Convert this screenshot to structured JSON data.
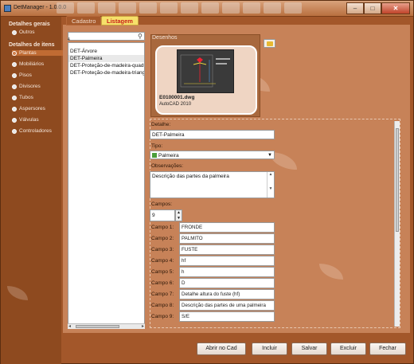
{
  "window": {
    "title": "DetManager - 1.0.0.0",
    "minimize": "–",
    "maximize": "□",
    "close": "✕"
  },
  "sidebar": {
    "general_title": "Detalhes gerais",
    "general_items": [
      {
        "label": "Outros"
      }
    ],
    "items_title": "Detalhes de itens",
    "items": [
      {
        "label": "Plantas",
        "selected": true
      },
      {
        "label": "Mobiliários"
      },
      {
        "label": "Pisos"
      },
      {
        "label": "Divisores"
      },
      {
        "label": "Tubos"
      },
      {
        "label": "Aspersores"
      },
      {
        "label": "Válvulas"
      },
      {
        "label": "Controladores"
      }
    ]
  },
  "tabs": [
    {
      "label": "Cadastro"
    },
    {
      "label": "Listagem",
      "active": true
    }
  ],
  "list": {
    "count_marker": "4",
    "items": [
      "DET-Árvore",
      "DET-Palmeira",
      "DET-Proteção-de-madeira-quadrada",
      "DET-Proteção-de-madeira-triangular"
    ],
    "selected_index": 1
  },
  "drawings": {
    "label": "Desenhos",
    "file": "E0100001.dwg",
    "app": "AutoCAD 2010"
  },
  "form": {
    "detalhe_label": "Detalhe:",
    "detalhe_value": "DET-Palmeira",
    "tipo_label": "Tipo:",
    "tipo_value": "Palmeira",
    "obs_label": "Observações:",
    "obs_value": "Descrição das partes da palmeira",
    "campos_label": "Campos:",
    "campos_value": "9"
  },
  "campos": [
    {
      "label": "Campo 1:",
      "value": "FRONDE"
    },
    {
      "label": "Campo 2:",
      "value": "PALMITO"
    },
    {
      "label": "Campo 3:",
      "value": "FUSTE"
    },
    {
      "label": "Campo 4:",
      "value": "hf"
    },
    {
      "label": "Campo 5:",
      "value": "h"
    },
    {
      "label": "Campo 6:",
      "value": "D"
    },
    {
      "label": "Campo 7:",
      "value": "Detalhe altura do fuste (hf)"
    },
    {
      "label": "Campo 8:",
      "value": "Descrição das partes de uma palmeira"
    },
    {
      "label": "Campo 9:",
      "value": "S/E"
    }
  ],
  "buttons": {
    "abrir": "Abrir no Cad",
    "incluir": "Incluir",
    "salvar": "Salvar",
    "excluir": "Excluir",
    "fechar": "Fechar"
  },
  "colors": {
    "background": "#8c4a1e",
    "panel": "#c78258",
    "tab_active": "#f6e06a"
  }
}
